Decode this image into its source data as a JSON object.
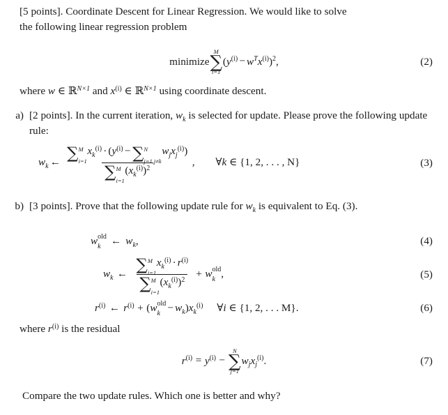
{
  "document": {
    "type": "homework-problem",
    "background_color": "#ffffff",
    "text_color": "#1a1a1a",
    "intro": {
      "line1": "[5 points]. Coordinate Descent for Linear Regression. We would like to solve",
      "line2": "the following linear regression problem"
    },
    "equation2": {
      "tag": "(2)",
      "operator_label": "minimize",
      "sum_upper": "M",
      "sum_lower": "i=1",
      "y": "y",
      "y_sup": "(i)",
      "minus": "−",
      "w": "w",
      "w_sup": "T",
      "x": "x",
      "x_sup": "(i)",
      "power": "2",
      "trailing": ","
    },
    "where_line": {
      "lead": "where ",
      "w": "w",
      "in1": " ∈ ",
      "R1": "ℝ",
      "R1_sup": "N×1",
      "and": " and ",
      "x": "x",
      "x_sup": "(i)",
      "in2": " ∈ ",
      "R2": "ℝ",
      "R2_sup": "N×1",
      "tail": " using coordinate descent."
    },
    "part_a": {
      "marker": "a)",
      "line1_pre": "[2 points]. In the current iteration, ",
      "line1_w": "w",
      "line1_w_sub": "k",
      "line1_post": " is selected for update. Please prove",
      "line2": "the following update rule:"
    },
    "equation3": {
      "tag": "(3)",
      "lhs_w": "w",
      "lhs_sub": "k",
      "arrow": "←",
      "num_sum_upper": "M",
      "num_sum_lower": "i=1",
      "num_x": "x",
      "num_x_sub": "k",
      "num_x_sup": "(i)",
      "cdot": "·",
      "num_y": "y",
      "num_y_sup": "(i)",
      "minus": "−",
      "inner_sum_upper": "N",
      "inner_sum_lower": "j=1,j≠k",
      "inner_w": "w",
      "inner_w_sub": "j",
      "inner_x": "x",
      "inner_x_sub": "j",
      "inner_x_sup": "(i)",
      "den_sum_upper": "M",
      "den_sum_lower": "i=1",
      "den_x": "x",
      "den_x_sub": "k",
      "den_x_sup": "(i)",
      "den_power": "2",
      "comma": ",",
      "forall": "∀",
      "forall_k": "k",
      "forall_in": " ∈ ",
      "forall_set": "{1, 2, . . . , N}"
    },
    "part_b": {
      "marker": "b)",
      "line1_pre": "[3 points]. Prove that the following update rule for ",
      "line1_w": "w",
      "line1_w_sub": "k",
      "line1_post": " is equivalent to",
      "line2": "Eq. (3)."
    },
    "equation4": {
      "tag": "(4)",
      "w": "w",
      "sub": "k",
      "sup": "old",
      "arrow": "←",
      "rhs_w": "w",
      "rhs_sub": "k",
      "trailing": ","
    },
    "equation5": {
      "tag": "(5)",
      "lhs_w": "w",
      "lhs_sub": "k",
      "arrow": "←",
      "num_sum_upper": "M",
      "num_sum_lower": "i=1",
      "num_x": "x",
      "num_x_sub": "k",
      "num_x_sup": "(i)",
      "cdot": "·",
      "num_r": "r",
      "num_r_sup": "(i)",
      "den_sum_upper": "M",
      "den_sum_lower": "i=1",
      "den_x": "x",
      "den_x_sub": "k",
      "den_x_sup": "(i)",
      "den_power": "2",
      "plus": "+",
      "rhs_w": "w",
      "rhs_sub": "k",
      "rhs_sup": "old",
      "trailing": ","
    },
    "equation6": {
      "tag": "(6)",
      "lhs_r": "r",
      "lhs_sup": "(i)",
      "arrow": "←",
      "r2": "r",
      "r2_sup": "(i)",
      "plus": "+",
      "w_old": "w",
      "w_old_sub": "k",
      "w_old_sup": "old",
      "minus": "−",
      "w_k": "w",
      "w_k_sub": "k",
      "x": "x",
      "x_sub": "k",
      "x_sup": "(i)",
      "forall": "∀",
      "forall_i": "i",
      "forall_in": " ∈ ",
      "forall_set": "{1, 2, . . . M}."
    },
    "residual_line": {
      "lead": "where ",
      "r": "r",
      "r_sup": "(i)",
      "tail": " is the residual"
    },
    "equation7": {
      "tag": "(7)",
      "lhs_r": "r",
      "lhs_sup": "(i)",
      "equals": "=",
      "y": "y",
      "y_sup": "(i)",
      "minus": "−",
      "sum_upper": "N",
      "sum_lower": "j=1",
      "w": "w",
      "w_sub": "j",
      "x": "x",
      "x_sub": "j",
      "x_sup": "(i)",
      "trailing": "."
    },
    "closing_line": "Compare the two update rules. Which one is better and why?"
  }
}
